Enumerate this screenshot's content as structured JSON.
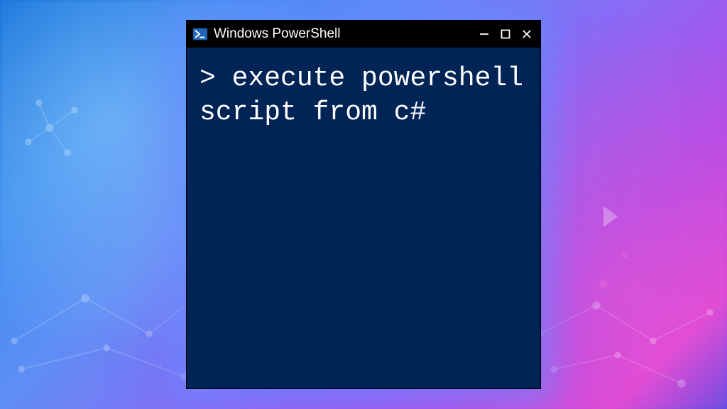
{
  "window": {
    "title": "Windows PowerShell",
    "icon": "powershell-icon"
  },
  "terminal": {
    "prompt": "> ",
    "command": "execute powershell script from c#"
  },
  "colors": {
    "terminal_bg": "#012456",
    "titlebar_bg": "#000000",
    "text": "#ffffff"
  }
}
